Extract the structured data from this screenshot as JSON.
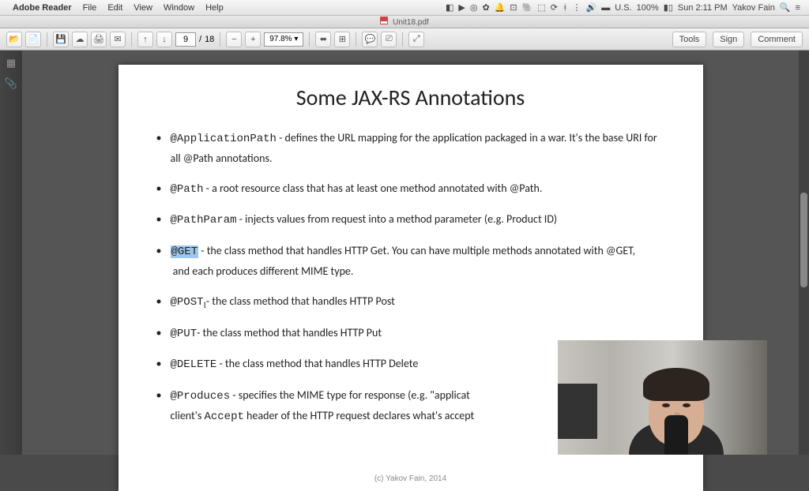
{
  "menubar": {
    "app": "Adobe Reader",
    "items": [
      "File",
      "Edit",
      "View",
      "Window",
      "Help"
    ],
    "status_right": [
      "U.S.",
      "100%",
      "Sun 2:11 PM",
      "Yakov Fain"
    ]
  },
  "tab": {
    "filename": "Unit18.pdf"
  },
  "toolbar": {
    "page_current": "9",
    "page_sep": "/",
    "page_total": "18",
    "zoom": "97.8%",
    "right": [
      "Tools",
      "Sign",
      "Comment"
    ]
  },
  "doc": {
    "title": "Some JAX-RS Annotations",
    "items": [
      {
        "code": "@ApplicationPath",
        "text": " - defines the URL mapping for the application packaged in a war. It's the base URI for all @Path annotations."
      },
      {
        "code": "@Path",
        "text": " - a root resource class that has at least one method annotated with @Path."
      },
      {
        "code": "@PathParam",
        "text": " - injects values from request into a method parameter (e.g. Product ID)"
      },
      {
        "code": "@GET",
        "hl": true,
        "text": " - the class method that handles HTTP Get. You can have multiple methods annotated with @GET,",
        "text2": "and each produces different MIME type."
      },
      {
        "code": "@POST",
        "cursor": true,
        "text": "- the class method that handles HTTP Post"
      },
      {
        "code": "@PUT",
        "text": "- the class method that handles HTTP Put"
      },
      {
        "code": "@DELETE",
        "text": " - the class method that handles HTTP Delete"
      },
      {
        "code": "@Produces",
        "text": " - specifies the MIME type for response (e.g. \"applicat",
        "extra_start": "client's ",
        "extra_code": "Accept",
        "extra_end": " header of the HTTP request declares what's accept"
      }
    ],
    "footer": "(c) Yakov Fain, 2014"
  }
}
